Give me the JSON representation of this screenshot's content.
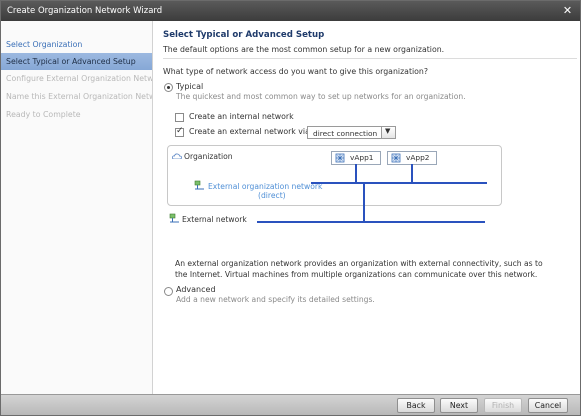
{
  "window": {
    "title": "Create Organization Network Wizard"
  },
  "sidebar": {
    "steps": [
      {
        "label": "Select Organization"
      },
      {
        "label": "Select Typical or Advanced Setup"
      },
      {
        "label": "Configure External Organization Network"
      },
      {
        "label": "Name this External Organization Network"
      },
      {
        "label": "Ready to Complete"
      }
    ]
  },
  "main": {
    "heading": "Select Typical or Advanced Setup",
    "subheading": "The default options are the most common setup for a new organization.",
    "question": "What type of network access do you want to give this organization?",
    "typical": {
      "label": "Typical",
      "description": "The quickest and most common way to set up networks for an organization.",
      "selected": true
    },
    "internal_checkbox": {
      "label": "Create an internal network",
      "checked": false
    },
    "external_checkbox": {
      "label": "Create an external network via:",
      "checked": true
    },
    "connection_select": {
      "value": "direct connection"
    },
    "diagram": {
      "organization_label": "Organization",
      "vapps": [
        "vApp1",
        "vApp2"
      ],
      "external_org_network_label": "External organization network",
      "external_org_network_sub": "(direct)",
      "external_network_label": "External network",
      "line_color": "#2a52be"
    },
    "description": "An external organization network provides an organization with external connectivity, such as to the Internet. Virtual machines from multiple organizations can communicate over this network.",
    "advanced": {
      "label": "Advanced",
      "description": "Add a new network and specify its detailed settings.",
      "selected": false
    }
  },
  "footer": {
    "back_label": "Back",
    "next_label": "Next",
    "finish_label": "Finish",
    "cancel_label": "Cancel"
  },
  "colors": {
    "accent_link": "#3a6fb7",
    "active_step": "#9cb9e0",
    "title_bar": "#4a4a4a"
  }
}
